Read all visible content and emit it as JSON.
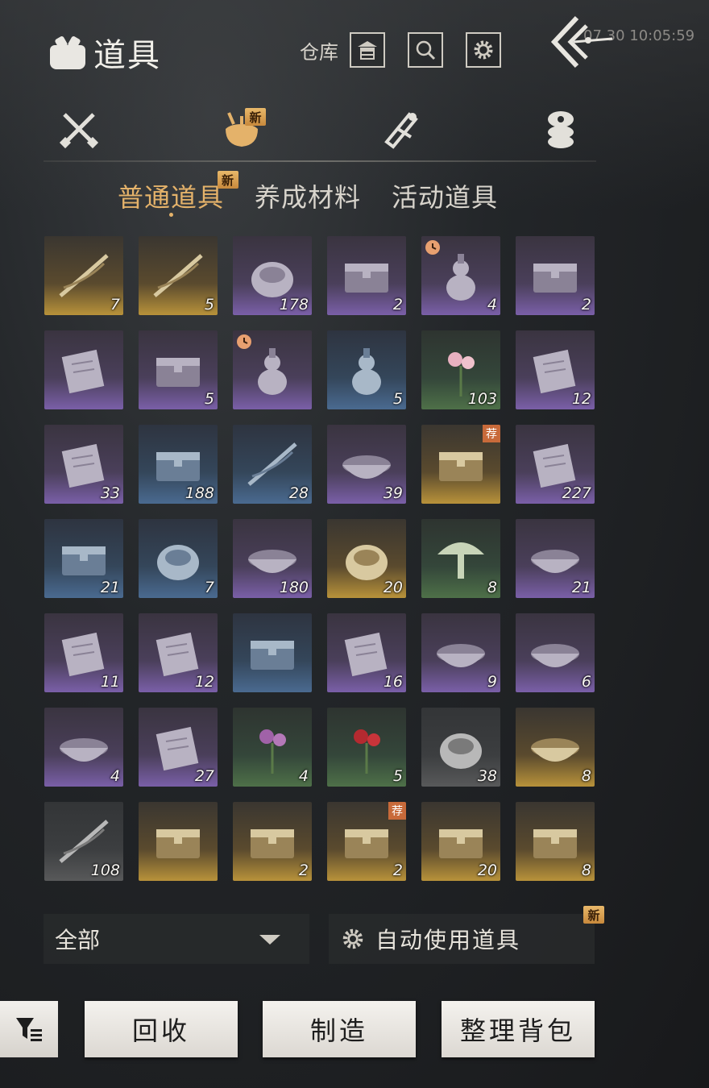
{
  "header": {
    "title": "道具",
    "warehouse_label": "仓库",
    "timestamp": "07.30 10:05:59",
    "icons": [
      "bag-icon",
      "warehouse-icon",
      "search-icon",
      "gear-icon",
      "back-icon"
    ]
  },
  "categories": [
    {
      "name": "weapons",
      "icon": "crossed-swords-icon"
    },
    {
      "name": "items",
      "icon": "bundle-icon",
      "new": "新",
      "active": true
    },
    {
      "name": "scrolls",
      "icon": "scroll-icon"
    },
    {
      "name": "currency",
      "icon": "coin-stack-icon"
    }
  ],
  "subtabs": [
    {
      "label": "普通道具",
      "new": "新",
      "active": true
    },
    {
      "label": "养成材料"
    },
    {
      "label": "活动道具"
    }
  ],
  "items": [
    {
      "count": "7",
      "rarity": "gold",
      "icon": "ink-ship-icon"
    },
    {
      "count": "5",
      "rarity": "gold",
      "icon": "ink-swirl-icon"
    },
    {
      "count": "178",
      "rarity": "purple",
      "icon": "cloth-pouch-icon"
    },
    {
      "count": "2",
      "rarity": "purple",
      "icon": "chest-pair-icon"
    },
    {
      "count": "4",
      "rarity": "purple",
      "icon": "gourd-vase-icon",
      "timed": true
    },
    {
      "count": "2",
      "rarity": "purple",
      "icon": "chest-pair-icon"
    },
    {
      "count": "",
      "rarity": "purple",
      "icon": "landscape-painting-icon"
    },
    {
      "count": "5",
      "rarity": "purple",
      "icon": "dark-chest-icon"
    },
    {
      "count": "",
      "rarity": "purple",
      "icon": "gourd-vase-icon",
      "timed": true
    },
    {
      "count": "5",
      "rarity": "blue",
      "icon": "teapot-icon"
    },
    {
      "count": "103",
      "rarity": "green",
      "icon": "plum-blossom-icon"
    },
    {
      "count": "12",
      "rarity": "purple",
      "icon": "paper-sheets-icon"
    },
    {
      "count": "33",
      "rarity": "purple",
      "icon": "paper-sheets-icon"
    },
    {
      "count": "188",
      "rarity": "blue",
      "icon": "pigment-box-icon"
    },
    {
      "count": "28",
      "rarity": "blue",
      "icon": "horn-icon"
    },
    {
      "count": "39",
      "rarity": "purple",
      "icon": "dish-icon"
    },
    {
      "count": "",
      "rarity": "gold",
      "icon": "official-chest-icon",
      "rec": "荐"
    },
    {
      "count": "227",
      "rarity": "purple",
      "icon": "golden-card-icon"
    },
    {
      "count": "21",
      "rarity": "blue",
      "icon": "jade-boxes-icon"
    },
    {
      "count": "7",
      "rarity": "blue",
      "icon": "ceramic-jar-icon"
    },
    {
      "count": "180",
      "rarity": "purple",
      "icon": "flour-bowl-icon"
    },
    {
      "count": "20",
      "rarity": "gold",
      "icon": "golden-bee-icon"
    },
    {
      "count": "8",
      "rarity": "green",
      "icon": "mushroom-icon"
    },
    {
      "count": "21",
      "rarity": "purple",
      "icon": "meat-dish-icon"
    },
    {
      "count": "11",
      "rarity": "purple",
      "icon": "talisman-icon"
    },
    {
      "count": "12",
      "rarity": "purple",
      "icon": "talisman-icon"
    },
    {
      "count": "",
      "rarity": "blue",
      "icon": "gift-box-icon"
    },
    {
      "count": "16",
      "rarity": "purple",
      "icon": "talisman-icon"
    },
    {
      "count": "9",
      "rarity": "purple",
      "icon": "stew-pot-icon"
    },
    {
      "count": "6",
      "rarity": "purple",
      "icon": "stew-pot-icon"
    },
    {
      "count": "4",
      "rarity": "purple",
      "icon": "dumpling-bowl-icon"
    },
    {
      "count": "27",
      "rarity": "purple",
      "icon": "flatbread-icon"
    },
    {
      "count": "4",
      "rarity": "green",
      "icon": "purple-flower-icon"
    },
    {
      "count": "5",
      "rarity": "green",
      "icon": "red-flower-icon"
    },
    {
      "count": "38",
      "rarity": "grey",
      "icon": "ore-stone-icon"
    },
    {
      "count": "8",
      "rarity": "gold",
      "icon": "porcelain-bowl-icon"
    },
    {
      "count": "108",
      "rarity": "grey",
      "icon": "arrows-icon"
    },
    {
      "count": "",
      "rarity": "gold",
      "icon": "official-chest-icon"
    },
    {
      "count": "2",
      "rarity": "gold",
      "icon": "heart-chest-icon"
    },
    {
      "count": "2",
      "rarity": "gold",
      "icon": "heart-chest-icon",
      "rec": "荐"
    },
    {
      "count": "20",
      "rarity": "gold",
      "icon": "shell-chest-icon"
    },
    {
      "count": "8",
      "rarity": "gold",
      "icon": "leaf-chest-icon"
    }
  ],
  "bottom": {
    "filter_label": "全部",
    "auto_use_label": "自动使用道具",
    "auto_use_new": "新",
    "buttons": [
      "回收",
      "制造",
      "整理背包"
    ]
  },
  "colors": {
    "accent_gold": "#e4b26a",
    "new_tag": "#d89a48",
    "purple_rarity": "#7a5fa8",
    "gold_rarity": "#b8923a",
    "blue_rarity": "#4a6a90",
    "green_rarity": "#4e7048"
  }
}
